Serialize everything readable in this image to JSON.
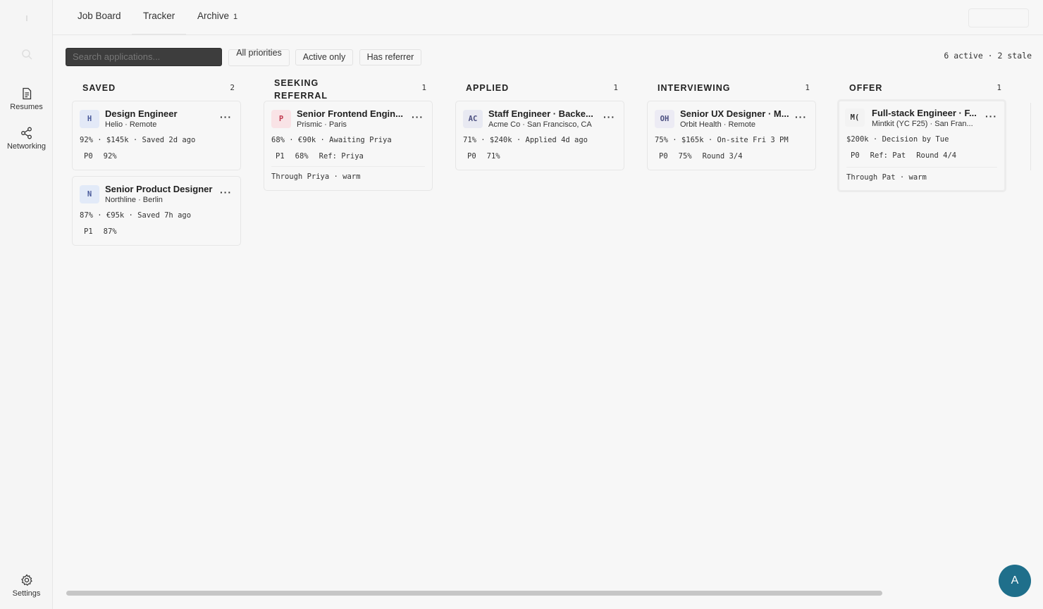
{
  "sidebar": {
    "items": [
      {
        "label": "Resumes",
        "icon": "document-icon"
      },
      {
        "label": "Networking",
        "icon": "share-icon"
      }
    ],
    "settings_label": "Settings"
  },
  "topbar": {
    "tabs": [
      {
        "label": "Job Board",
        "count": ""
      },
      {
        "label": "Tracker",
        "count": ""
      },
      {
        "label": "Archive",
        "count": "1"
      }
    ]
  },
  "filters": {
    "search_placeholder": "Search applications...",
    "chips": [
      "All priorities",
      "Active only",
      "Has referrer"
    ],
    "summary": "6 active · 2 stale"
  },
  "columns": [
    {
      "title": "SAVED",
      "count": "2",
      "cards": [
        {
          "initials": "H",
          "title": "Design Engineer",
          "sub": "Helio · Remote",
          "meta": "92%  ·  $145k  ·  Saved 2d ago",
          "tags": [
            "P0",
            "92%"
          ],
          "ref": ""
        },
        {
          "initials": "N",
          "title": "Senior Product Designer",
          "sub": "Northline · Berlin",
          "meta": "87%  ·  €95k  ·  Saved 7h ago",
          "tags": [
            "P1",
            "87%"
          ],
          "ref": ""
        }
      ]
    },
    {
      "title": "SEEKING REFERRAL",
      "count": "1",
      "cards": [
        {
          "initials": "P",
          "title": "Senior Frontend Engin...",
          "sub": "Prismic · Paris",
          "meta": "68%  ·  €90k  ·  Awaiting Priya",
          "tags": [
            "P1",
            "68%",
            "Ref: Priya"
          ],
          "ref": "Through Priya · warm"
        }
      ]
    },
    {
      "title": "APPLIED",
      "count": "1",
      "cards": [
        {
          "initials": "AC",
          "title": "Staff Engineer · Backe...",
          "sub": "Acme Co · San Francisco, CA",
          "meta": "71%  ·  $240k  ·  Applied 4d ago",
          "tags": [
            "P0",
            "71%"
          ],
          "ref": ""
        }
      ]
    },
    {
      "title": "INTERVIEWING",
      "count": "1",
      "cards": [
        {
          "initials": "OH",
          "title": "Senior UX Designer · M...",
          "sub": "Orbit Health · Remote",
          "meta": "75%  ·  $165k  ·  On-site Fri 3 PM",
          "tags": [
            "P0",
            "75%",
            "Round 3/4"
          ],
          "ref": ""
        }
      ]
    },
    {
      "title": "OFFER",
      "count": "1",
      "cards": [
        {
          "initials": "M(",
          "title": "Full-stack Engineer · F...",
          "sub": "Mintkit (YC F25) · San Fran...",
          "meta": "$200k  ·  Decision by Tue",
          "tags": [
            "P0",
            "Ref: Pat",
            "Round 4/4"
          ],
          "ref": "Through Pat · warm"
        }
      ]
    }
  ],
  "fab_label": "A",
  "colors": {
    "accent": "#1f6f8b",
    "search_bg": "#3d3d3d",
    "avatar_h": "#e3e9f7",
    "avatar_n": "#e2eaf8",
    "avatar_p": "#f9e3e6",
    "avatar_ac": "#e8e9f2",
    "avatar_oh": "#ecebf4",
    "avatar_m": "#f3f3f3"
  }
}
